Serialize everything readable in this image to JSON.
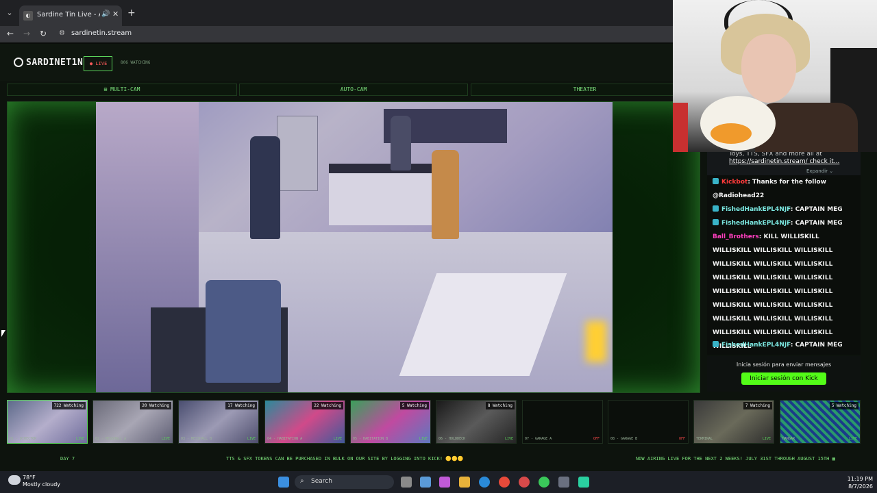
{
  "browser": {
    "tab_title": "Sardine Tin Live - All Rooms",
    "url": "sardinetin.stream"
  },
  "site": {
    "logo": "SARDINET1N",
    "live_label": "● LIVE",
    "watching": "806 WATCHING",
    "modes": [
      "⊞ MULTI-CAM",
      "AUTO-CAM",
      "THEATER"
    ]
  },
  "chat": {
    "pinned_text": "Toys, TTS, SFX and more all at",
    "pinned_link": "https://sardinetin.stream/ check it...",
    "expand_label": "Expandir ⌄",
    "messages": [
      {
        "user": "Kickbot",
        "text": "Thanks for the follow @Radiohead22"
      },
      {
        "user": "FishedHankEPL4NJF",
        "text": "CAPTAIN MEG"
      },
      {
        "user": "FishedHankEPL4NJF",
        "text": "CAPTAIN MEG"
      },
      {
        "user": "Ball_Brothers",
        "text": "KILL WILLISKILL WILLISKILL WILLISKILL WILLISKILL WILLISKILL WILLISKILL WILLISKILL WILLISKILL WILLISKILL WILLISKILL WILLISKILL WILLISKILL WILLISKILL WILLISKILL WILLISKILL WILLISKILL WILLISKILL WILLISKILL WILLISKILL WILLISKILL WILLISKILL WILLISKILL WILLISKILL"
      },
      {
        "user": "FishedHankEPL4NJF",
        "text": "CAPTAIN MEG"
      }
    ],
    "login_prompt": "Inicia sesión para enviar mensajes",
    "login_button": "Iniciar sesión con Kick"
  },
  "thumbnails": [
    {
      "watching": "722 Watching",
      "label": "01 - DIRECTOR",
      "status": "LIVE"
    },
    {
      "watching": "20 Watching",
      "label": "02 - MESSHALL A",
      "status": "LIVE"
    },
    {
      "watching": "17 Watching",
      "label": "03 - MESSHALL B",
      "status": "LIVE"
    },
    {
      "watching": "22 Watching",
      "label": "04 - HABITATION A",
      "status": "LIVE"
    },
    {
      "watching": "5 Watching",
      "label": "05 - HABITATION B",
      "status": "LIVE"
    },
    {
      "watching": "8 Watching",
      "label": "06 - HOLDDECK",
      "status": "LIVE"
    },
    {
      "watching": "",
      "label": "07 - GARAGE A",
      "status": "OFF"
    },
    {
      "watching": "",
      "label": "08 - GARAGE B",
      "status": "OFF"
    },
    {
      "watching": "7 Watching",
      "label": "TERMINAL",
      "status": "LIVE"
    },
    {
      "watching": "5 Watching",
      "label": "HANGAR",
      "status": "LIVE"
    }
  ],
  "ticker": {
    "day": "DAY 7",
    "tokens": "TTS & SFX TOKENS CAN BE PURCHASED IN BULK ON OUR SITE BY LOGGING INTO KICK! 🟡🟡🟡",
    "airing": "NOW AIRING LIVE FOR THE NEXT 2 WEEKS! JULY 31ST THROUGH AUGUST 15TH ▦"
  },
  "taskbar": {
    "temp": "78°F",
    "weather": "Mostly cloudy",
    "search": "Search",
    "time": "11:19 PM",
    "date": "8/7/2026"
  },
  "colors": {
    "accent": "#5bd45b",
    "kick_green": "#53fc18",
    "live_red": "#ff5a5a"
  }
}
